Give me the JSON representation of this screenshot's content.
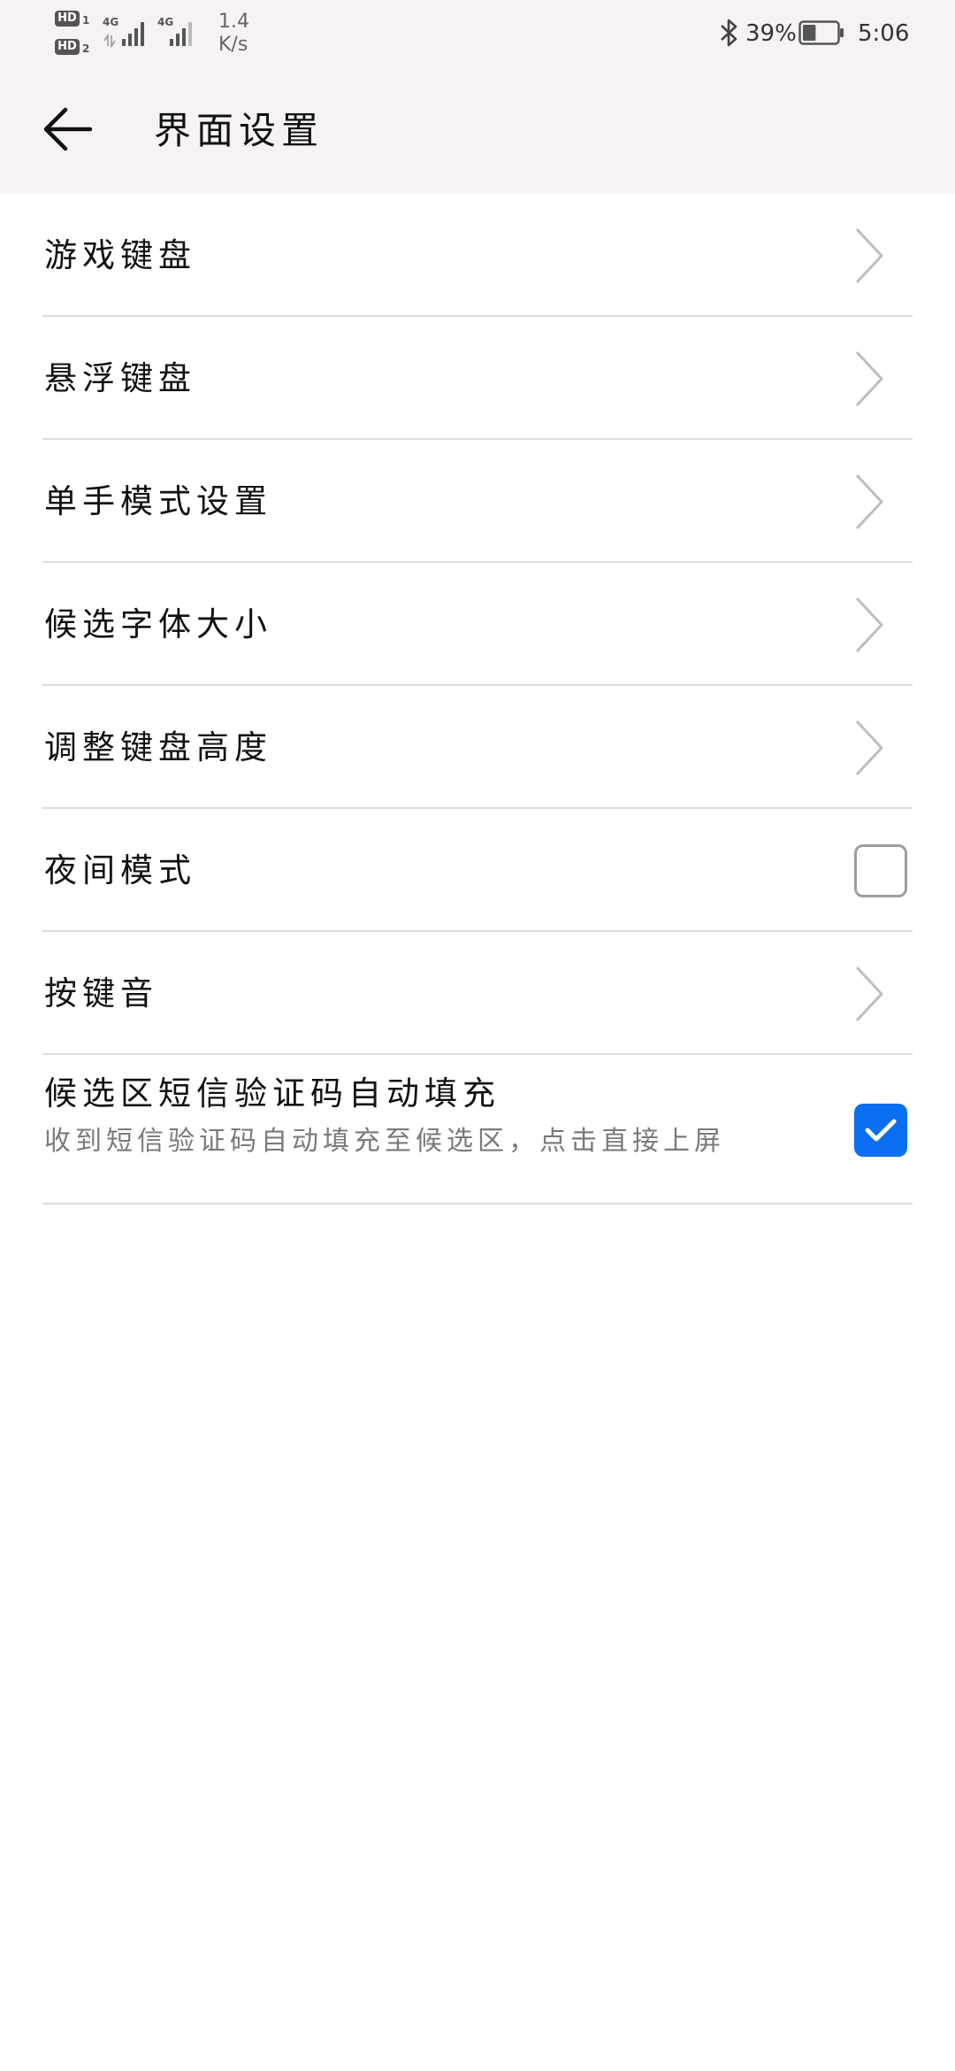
{
  "status_bar": {
    "sim1_badge": "HD",
    "sim1_index": "1",
    "sim2_badge": "HD",
    "sim2_index": "2",
    "sim1_network": "4G",
    "sim2_network": "4G",
    "net_speed_value": "1.4",
    "net_speed_unit": "K/s",
    "battery_percent": "39%",
    "battery_level": 0.39,
    "time": "5:06",
    "icons": [
      "bluetooth-icon",
      "signal-icon",
      "battery-icon"
    ]
  },
  "app_bar": {
    "back_icon": "arrow-left-icon",
    "title": "界面设置"
  },
  "settings": {
    "items": [
      {
        "label": "游戏键盘",
        "control": "chevron"
      },
      {
        "label": "悬浮键盘",
        "control": "chevron"
      },
      {
        "label": "单手模式设置",
        "control": "chevron"
      },
      {
        "label": "候选字体大小",
        "control": "chevron"
      },
      {
        "label": "调整键盘高度",
        "control": "chevron"
      },
      {
        "label": "夜间模式",
        "control": "checkbox",
        "checked": false
      },
      {
        "label": "按键音",
        "control": "chevron"
      },
      {
        "label": "候选区短信验证码自动填充",
        "subtitle": "收到短信验证码自动填充至候选区，点击直接上屏",
        "control": "checkbox",
        "checked": true
      }
    ]
  },
  "colors": {
    "header_background": "#f6f2f5",
    "accent": "#0a6ff2",
    "divider": "#dcdcdc",
    "chevron": "#bdbdbd",
    "subtitle_text": "#7a7a7a"
  }
}
